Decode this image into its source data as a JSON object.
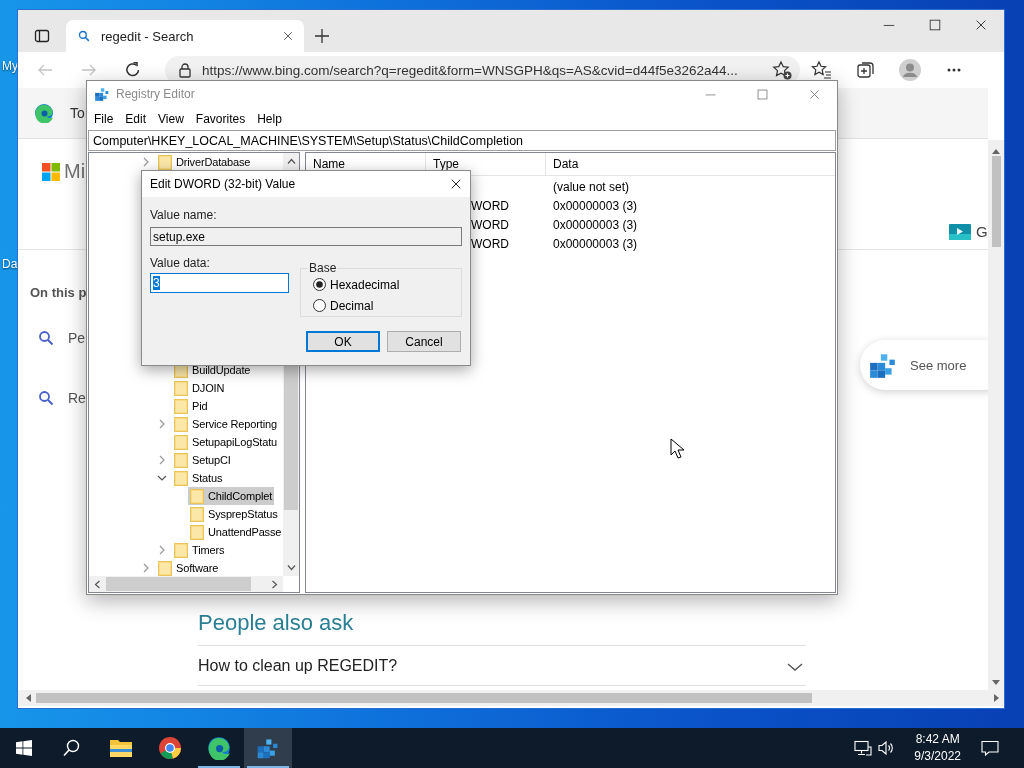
{
  "desktop": {
    "icon_labels": [
      {
        "text": "My"
      },
      {
        "text": "Da"
      }
    ]
  },
  "browser": {
    "tabs": [
      {
        "title": "regedit - Search",
        "selected": true
      }
    ],
    "nav": [
      {
        "kind": "back",
        "disabled": true
      },
      {
        "kind": "forward",
        "disabled": true
      },
      {
        "kind": "refresh",
        "disabled": false
      }
    ],
    "address": "https://www.bing.com/search?q=regedit&form=WNSGPH&qs=AS&cvid=d44f5e3262a44...",
    "page": {
      "header_text": "To",
      "logo_text": "Mi",
      "sidebar_heading": "On this p",
      "links": [
        {
          "text": "Pe"
        },
        {
          "text": "Re"
        }
      ],
      "video_label": "G",
      "see_more": "See more",
      "section_title": "People also ask",
      "questions": [
        {
          "text": "How to clean up REGEDIT?",
          "expanded": false
        }
      ]
    }
  },
  "registry_editor": {
    "title": "Registry Editor",
    "menu": [
      "File",
      "Edit",
      "View",
      "Favorites",
      "Help"
    ],
    "address": "Computer\\HKEY_LOCAL_MACHINE\\SYSTEM\\Setup\\Status\\ChildCompletion",
    "tree": [
      {
        "label": "DriverDatabase",
        "expanded": false,
        "selected": false
      },
      {
        "children": [
          {
            "label": "BuildUpdate",
            "selected": false
          },
          {
            "label": "DJOIN",
            "selected": false
          },
          {
            "label": "Pid",
            "selected": false
          },
          {
            "label": "Service Reporting",
            "expanded": false,
            "selected": false
          },
          {
            "label": "SetupapiLogStatu",
            "selected": false
          },
          {
            "label": "SetupCI",
            "expanded": false,
            "selected": false
          },
          {
            "label": "Status",
            "expanded": true,
            "selected": false,
            "children": [
              {
                "label": "ChildComplet",
                "selected": true
              },
              {
                "label": "SysprepStatus",
                "selected": false
              },
              {
                "label": "UnattendPasse",
                "selected": false
              }
            ]
          },
          {
            "label": "Timers",
            "expanded": false,
            "selected": false
          }
        ]
      },
      {
        "label": "Software",
        "expanded": false,
        "selected": false
      }
    ],
    "columns": [
      "Name",
      "Type",
      "Data"
    ],
    "rows": [
      {
        "data": "(value not set)"
      },
      {
        "type": "WORD",
        "data": "0x00000003 (3)"
      },
      {
        "type": "WORD",
        "data": "0x00000003 (3)"
      },
      {
        "type": "WORD",
        "data": "0x00000003 (3)"
      }
    ]
  },
  "dialog": {
    "title": "Edit DWORD (32-bit) Value",
    "value_name_label": "Value name:",
    "value_name": "setup.exe",
    "value_data_label": "Value data:",
    "value_data": "3",
    "value_data_selected": true,
    "base_label": "Base",
    "bases": [
      {
        "label": "Hexadecimal",
        "selected": true
      },
      {
        "label": "Decimal",
        "selected": false
      }
    ],
    "buttons": [
      {
        "label": "OK",
        "default": true
      },
      {
        "label": "Cancel",
        "default": false
      }
    ]
  },
  "taskbar": {
    "apps": [
      {
        "kind": "explorer",
        "running": false,
        "selected": false
      },
      {
        "kind": "chrome",
        "running": false,
        "selected": false
      },
      {
        "kind": "edge",
        "running": true,
        "selected": false
      },
      {
        "kind": "regedit",
        "running": true,
        "selected": true
      }
    ],
    "time": "8:42 AM",
    "date": "9/3/2022"
  }
}
